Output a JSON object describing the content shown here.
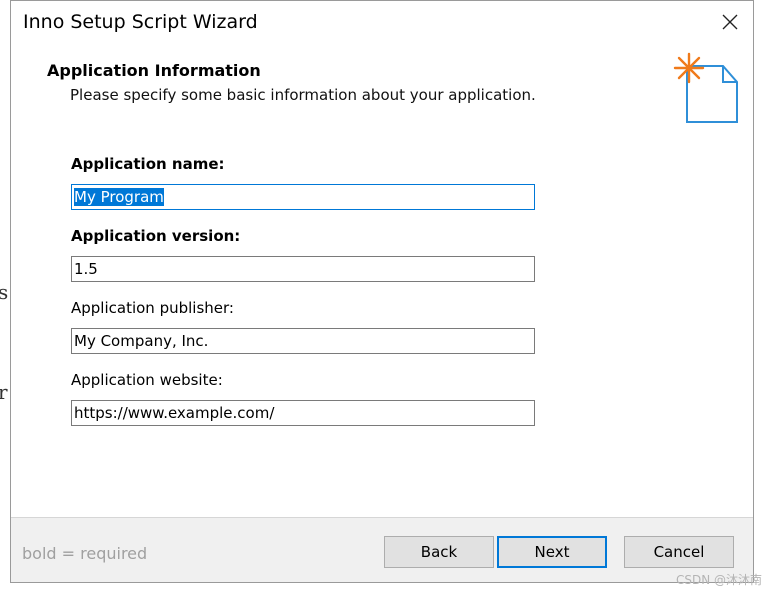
{
  "window": {
    "title": "Inno Setup Script Wizard"
  },
  "header": {
    "title": "Application Information",
    "subtitle": "Please specify some basic information about your application.",
    "icon": "new-document-sparkle-icon"
  },
  "fields": {
    "name": {
      "label": "Application name:",
      "value": "My Program"
    },
    "version": {
      "label": "Application version:",
      "value": "1.5"
    },
    "publisher": {
      "label": "Application publisher:",
      "value": "My Company, Inc."
    },
    "website": {
      "label": "Application website:",
      "value": "https://www.example.com/"
    }
  },
  "footer": {
    "hint_bold": "bold",
    "hint_rest": "= required",
    "back_label": "Back",
    "next_label": "Next",
    "cancel_label": "Cancel"
  },
  "watermark": "CSDN @沐沐南",
  "colors": {
    "accent": "#0078d7",
    "footer_bg": "#f0f0f0",
    "icon_orange": "#f07a1a",
    "icon_blue": "#2f8fd8"
  }
}
